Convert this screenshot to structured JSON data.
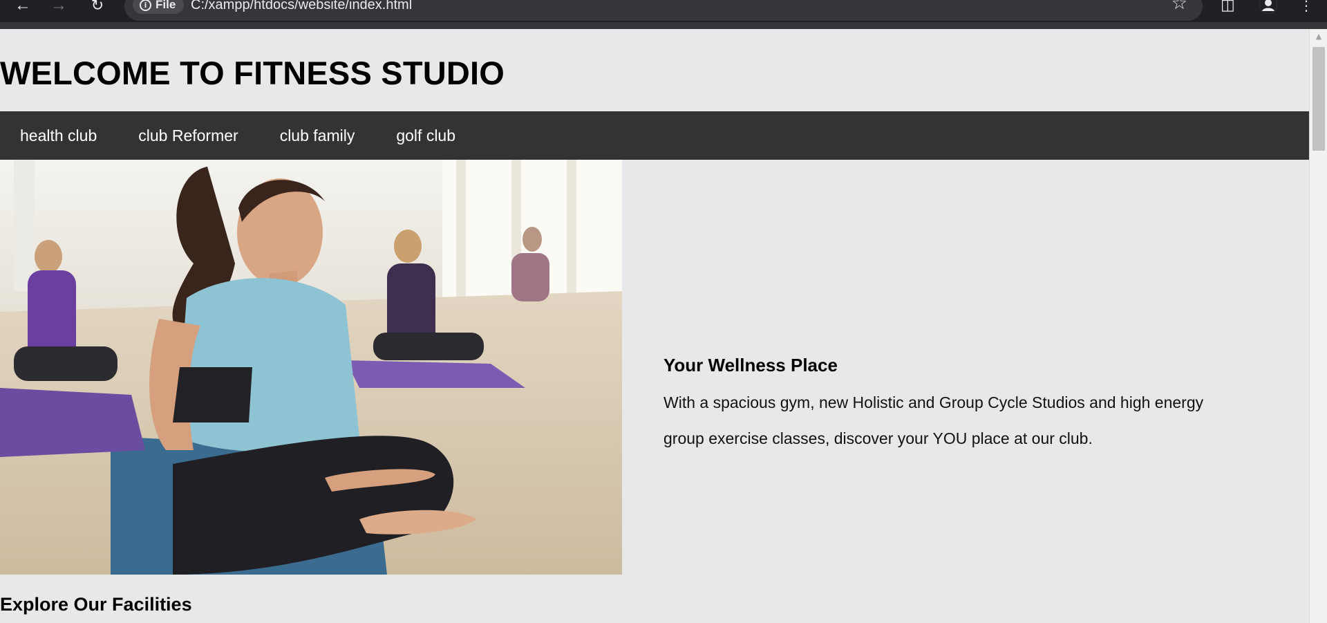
{
  "browser": {
    "file_chip_label": "File",
    "url": "C:/xampp/htdocs/website/index.html",
    "icons": [
      "back-arrow-icon",
      "forward-arrow-icon",
      "reload-icon",
      "info-icon",
      "star-icon",
      "side-panel-icon",
      "profile-icon",
      "kebab-menu-icon"
    ]
  },
  "header": {
    "title": "WELCOME TO FITNESS STUDIO"
  },
  "nav": {
    "items": [
      {
        "label": "health club"
      },
      {
        "label": "club Reformer"
      },
      {
        "label": "club family"
      },
      {
        "label": "golf club"
      }
    ]
  },
  "hero": {
    "image_subject": "woman in teal top smiling seated on yoga mat in a fitness class",
    "title": "Your Wellness Place",
    "description": "With a spacious gym, new Holistic and Group Cycle Studios and high energy group exercise classes, discover your YOU place at our club."
  },
  "facilities": {
    "title": "Explore Our Facilities"
  },
  "colors": {
    "page_bg": "#e8e8ea",
    "navbar_bg": "#333333",
    "chrome_bg": "#202124"
  }
}
